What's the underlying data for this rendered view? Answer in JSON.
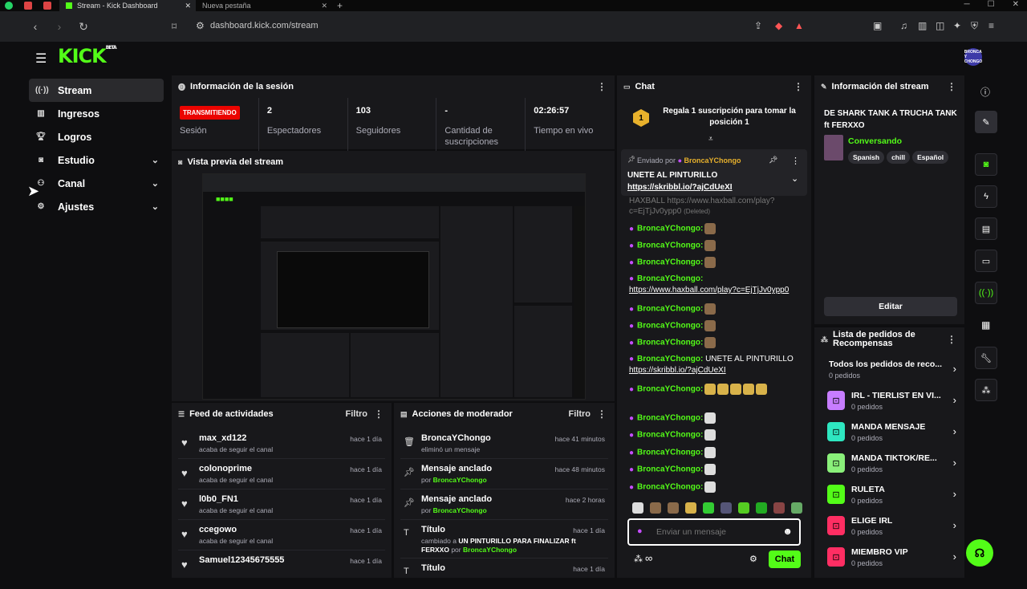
{
  "browser": {
    "tabs": [
      {
        "label": "Stream - Kick Dashboard",
        "active": true
      },
      {
        "label": "Nueva pestaña",
        "active": false
      }
    ],
    "url": "dashboard.kick.com/stream"
  },
  "app": {
    "logo": "KICK",
    "logo_sup": "BETA",
    "avatar_text": "BRONCA Y CHONGO"
  },
  "sidebar": {
    "items": [
      {
        "label": "Stream",
        "icon": "broadcast-icon",
        "active": true
      },
      {
        "label": "Ingresos",
        "icon": "chart-icon"
      },
      {
        "label": "Logros",
        "icon": "trophy-icon"
      },
      {
        "label": "Estudio",
        "icon": "camera-icon",
        "expandable": true
      },
      {
        "label": "Canal",
        "icon": "users-icon",
        "expandable": true
      },
      {
        "label": "Ajustes",
        "icon": "gear-icon",
        "expandable": true
      }
    ]
  },
  "session": {
    "title": "Información de la sesión",
    "status": "TRANSMITIENDO",
    "status_label": "Sesión",
    "stats": [
      {
        "value": "2",
        "label": "Espectadores"
      },
      {
        "value": "103",
        "label": "Seguidores"
      },
      {
        "value": "-",
        "label": "Cantidad de suscripciones"
      },
      {
        "value": "02:26:57",
        "label": "Tiempo en vivo"
      }
    ]
  },
  "preview": {
    "title": "Vista previa del stream"
  },
  "activity": {
    "title": "Feed de actividades",
    "filter": "Filtro",
    "items": [
      {
        "name": "max_xd122",
        "action": "acaba de seguir el canal",
        "time": "hace 1 día"
      },
      {
        "name": "colonoprime",
        "action": "acaba de seguir el canal",
        "time": "hace 1 día"
      },
      {
        "name": "l0b0_FN1",
        "action": "acaba de seguir el canal",
        "time": "hace 1 día"
      },
      {
        "name": "ccegowo",
        "action": "acaba de seguir el canal",
        "time": "hace 1 día"
      },
      {
        "name": "Samuel12345675555",
        "action": "",
        "time": "hace 1 día"
      }
    ]
  },
  "modactions": {
    "title": "Acciones de moderador",
    "filter": "Filtro",
    "items": [
      {
        "title": "BroncaYChongo",
        "sub": "eliminó un mensaje",
        "by": "",
        "time": "hace 41 minutos",
        "icon": "trash-icon"
      },
      {
        "title": "Mensaje anclado",
        "sub": "por",
        "by": "BroncaYChongo",
        "time": "hace 48 minutos",
        "icon": "pin-icon"
      },
      {
        "title": "Mensaje anclado",
        "sub": "por",
        "by": "BroncaYChongo",
        "time": "hace 2 horas",
        "icon": "pin-icon"
      },
      {
        "title": "Título",
        "sub": "cambiado a",
        "by": "BroncaYChongo",
        "time": "hace 1 día",
        "icon": "title-icon",
        "detail": "UN PINTURILLO PARA FINALIZAR ft FERXXO",
        "detail_by": "por"
      },
      {
        "title": "Título",
        "sub": "",
        "by": "",
        "time": "hace 1 día",
        "icon": "title-icon"
      }
    ]
  },
  "chat": {
    "title": "Chat",
    "gift_text": "Regala 1 suscripción para tomar la posición 1",
    "gift_rank": "1",
    "pinned": {
      "sent_by": "Enviado por",
      "user": "BroncaYChongo",
      "text": "UNETE AL PINTURILLO",
      "link": "https://skribbl.io/?ajCdUeXI"
    },
    "deleted_line": {
      "text": "HAXBALL https://www.haxball.com/play?c=EjTjJv0ypp0",
      "tag": "(Deleted)"
    },
    "messages": [
      {
        "user": "BroncaYChongo",
        "text": ""
      },
      {
        "user": "BroncaYChongo",
        "text": ""
      },
      {
        "user": "BroncaYChongo",
        "text": ""
      },
      {
        "user": "BroncaYChongo",
        "text": "",
        "link": "https://www.haxball.com/play?c=EjTjJv0ypp0"
      },
      {
        "user": "BroncaYChongo",
        "text": ""
      },
      {
        "user": "BroncaYChongo",
        "text": ""
      },
      {
        "user": "BroncaYChongo",
        "text": ""
      },
      {
        "user": "BroncaYChongo",
        "text": "UNETE AL PINTURILLO",
        "link": "https://skribbl.io/?ajCdUeXI"
      },
      {
        "user": "BroncaYChongo",
        "text": ""
      },
      {
        "user": "BroncaYChongo",
        "text": ""
      },
      {
        "user": "BroncaYChongo",
        "text": ""
      },
      {
        "user": "BroncaYChongo",
        "text": ""
      },
      {
        "user": "BroncaYChongo",
        "text": ""
      },
      {
        "user": "BroncaYChongo",
        "text": ""
      }
    ],
    "input_placeholder": "Enviar un mensaje",
    "send_label": "Chat"
  },
  "streaminfo": {
    "title": "Información del stream",
    "stream_title": "DE SHARK TANK A TRUCHA TANK ft FERXXO",
    "category": "Conversando",
    "tags": [
      "Spanish",
      "chill",
      "Español"
    ],
    "edit_label": "Editar"
  },
  "rewards": {
    "title": "Lista de pedidos de Recompensas",
    "items": [
      {
        "name": "Todos los pedidos de reco...",
        "count": "0 pedidos",
        "color": ""
      },
      {
        "name": "IRL - TIERLIST EN VI...",
        "count": "0 pedidos",
        "color": "#c77dff"
      },
      {
        "name": "MANDA MENSAJE",
        "count": "0 pedidos",
        "color": "#2ee6c0"
      },
      {
        "name": "MANDA TIKTOK/RE...",
        "count": "0 pedidos",
        "color": "#8af07a"
      },
      {
        "name": "RULETA",
        "count": "0 pedidos",
        "color": "#53fc18"
      },
      {
        "name": "ELIGE IRL",
        "count": "0 pedidos",
        "color": "#ff2e63"
      },
      {
        "name": "MIEMBRO VIP",
        "count": "0 pedidos",
        "color": "#ff2e63"
      }
    ]
  },
  "colors": {
    "accent": "#53fc18",
    "live": "#eb0400",
    "bg": "#0e0e10",
    "panel": "#18181b"
  }
}
